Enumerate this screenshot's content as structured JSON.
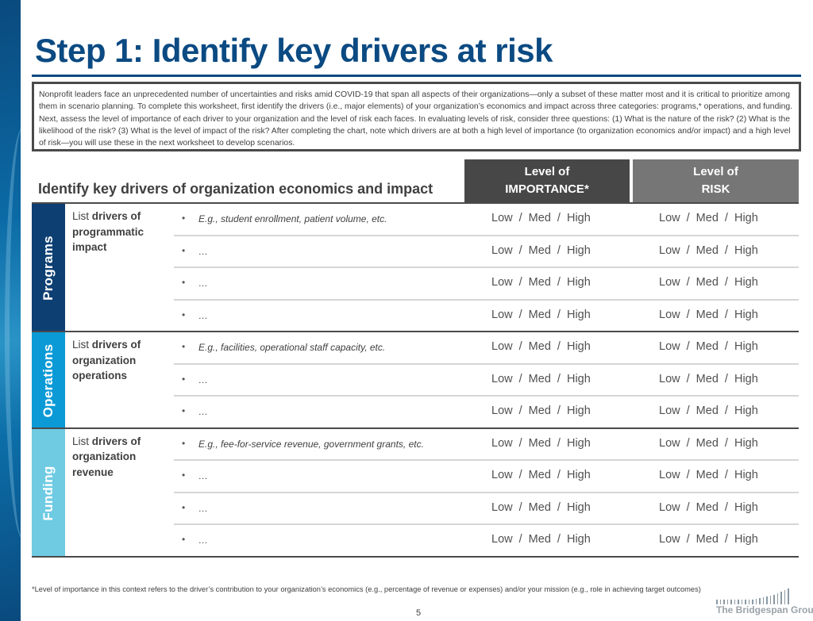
{
  "header": {
    "title_bold": "Step 1:",
    "title_rest": " Identify key drivers at risk"
  },
  "intro": {
    "text": "Nonprofit leaders face an unprecedented number of uncertainties and risks amid COVID-19 that span all aspects of their organizations—only a subset of these matter most and it is critical to prioritize among them in scenario planning. To complete this worksheet, first identify the drivers (i.e., major elements) of your organization’s economics and impact across three categories: programs,* operations, and funding. Next, assess the level of importance of each driver to your organization and the level of risk each faces. In evaluating levels of risk, consider three questions: (1) What is the nature of the risk? (2) What is the likelihood of the risk? (3) What is the level of impact of the risk? After completing the chart, note which drivers are at both a high level of importance (to organization economics and/or impact) and a high level of risk—you will use these in the next worksheet to develop scenarios."
  },
  "table": {
    "title": "Identify key drivers of organization economics and impact",
    "importance_header": [
      "Level of",
      "IMPORTANCE*"
    ],
    "risk_header": [
      "Level of",
      "RISK"
    ],
    "rating_scale": "Low / Med / High",
    "bullet": "•",
    "sections": [
      {
        "label": "Programs",
        "color": "#0d3f73",
        "desc_prefix": "List ",
        "desc_bold": "drivers of programmatic impact",
        "rows": [
          {
            "driver": "E.g., student enrollment, patient volume, etc."
          },
          {
            "driver": "…"
          },
          {
            "driver": "…"
          },
          {
            "driver": "…"
          }
        ]
      },
      {
        "label": "Operations",
        "color": "#0b9ad6",
        "desc_prefix": "List ",
        "desc_bold": "drivers of organization operations",
        "rows": [
          {
            "driver": "E.g., facilities, operational staff capacity, etc."
          },
          {
            "driver": "…"
          },
          {
            "driver": "…"
          }
        ]
      },
      {
        "label": "Funding",
        "color": "#6ecbe2",
        "desc_prefix": "List ",
        "desc_bold": "drivers of organization revenue",
        "rows": [
          {
            "driver": "E.g., fee-for-service revenue, government grants, etc."
          },
          {
            "driver": "…"
          },
          {
            "driver": "…"
          },
          {
            "driver": "…"
          }
        ]
      }
    ]
  },
  "footer": {
    "footnote": "*Level of importance in this context refers to the driver’s contribution to your organization’s economics (e.g., percentage of revenue or expenses) and/or your mission (e.g., role in achieving target outcomes)",
    "page_number": "5",
    "logo_text": "The Bridgespan Group"
  }
}
